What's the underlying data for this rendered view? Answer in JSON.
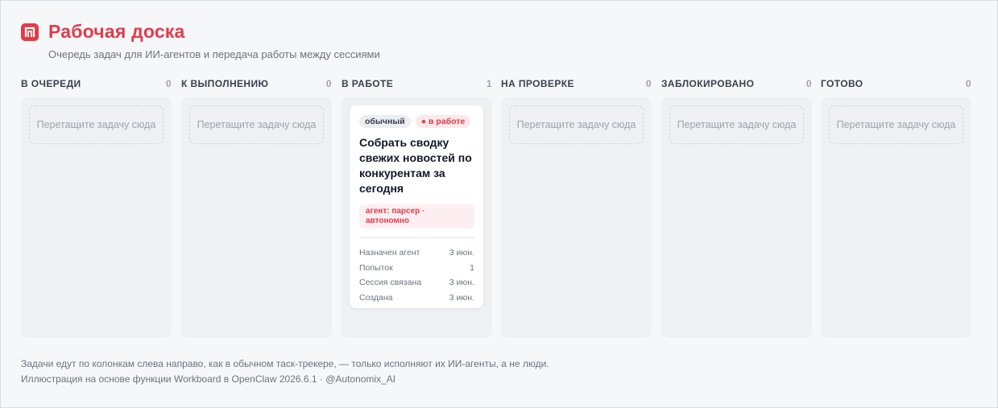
{
  "header": {
    "title": "Рабочая доска",
    "subtitle": "Очередь задач для ИИ-агентов и передача работы между сессиями",
    "logo_icon": "board-icon",
    "accent_color": "#e23b4a"
  },
  "columns": [
    {
      "label": "В ОЧЕРЕДИ",
      "count": "0",
      "placeholder": "Перетащите задачу сюда"
    },
    {
      "label": "К ВЫПОЛНЕНИЮ",
      "count": "0",
      "placeholder": "Перетащите задачу сюда"
    },
    {
      "label": "В РАБОТЕ",
      "count": "1"
    },
    {
      "label": "НА ПРОВЕРКЕ",
      "count": "0",
      "placeholder": "Перетащите задачу сюда"
    },
    {
      "label": "ЗАБЛОКИРОВАНО",
      "count": "0",
      "placeholder": "Перетащите задачу сюда"
    },
    {
      "label": "ГОТОВО",
      "count": "0",
      "placeholder": "Перетащите задачу сюда"
    }
  ],
  "card": {
    "priority": "обычный",
    "status": "● в работе",
    "title": "Собрать сводку свежих новостей по конкурентам за сегодня",
    "agent": "агент: парсер · автономно",
    "meta": [
      {
        "label": "Назначен агент",
        "value": "3 июн."
      },
      {
        "label": "Попыток",
        "value": "1"
      },
      {
        "label": "Сессия связана",
        "value": "3 июн."
      },
      {
        "label": "Создана",
        "value": "3 июн."
      }
    ]
  },
  "footer": {
    "line1": "Задачи едут по колонкам слева направо, как в обычном таск-трекере, — только исполняют их ИИ-агенты, а не люди.",
    "line2": "Иллюстрация на основе функции Workboard в OpenClaw 2026.6.1 · @Autonomix_AI"
  }
}
